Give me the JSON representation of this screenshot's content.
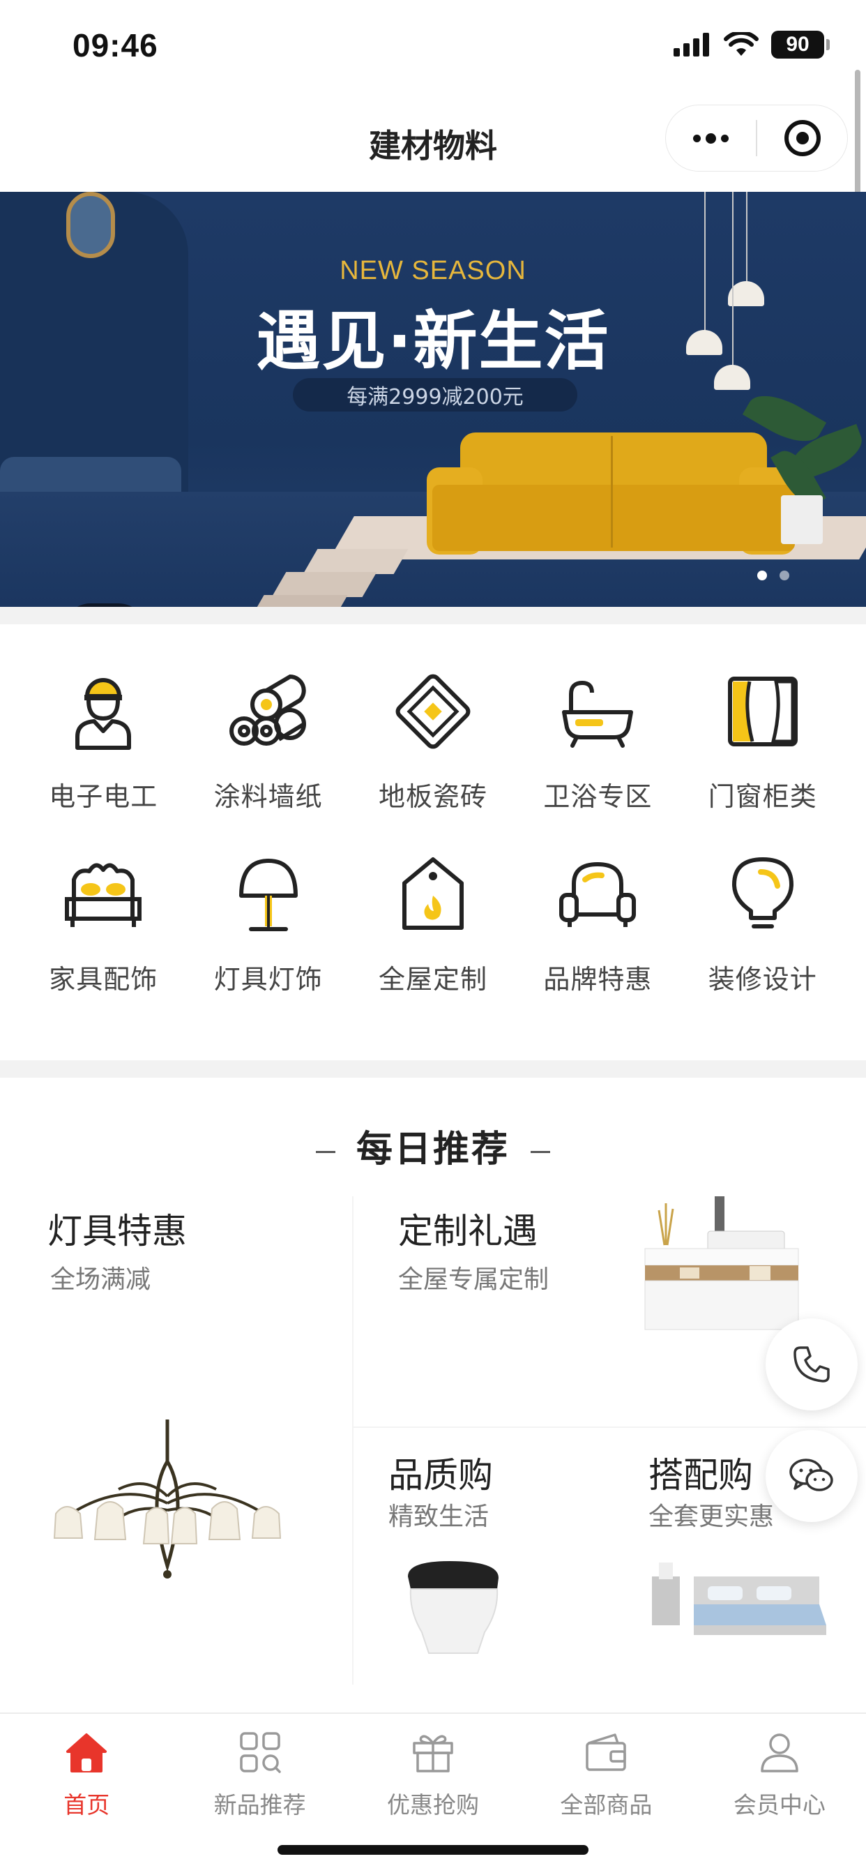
{
  "status_bar": {
    "time": "09:46",
    "battery": "90"
  },
  "nav": {
    "title": "建材物料"
  },
  "banner": {
    "subtitle": "NEW SEASON",
    "title": "遇见·新生活",
    "promo": "每满2999减200元",
    "slide_count": 2,
    "active_slide": 1
  },
  "categories": [
    {
      "label": "电子电工",
      "icon": "electrician-icon"
    },
    {
      "label": "涂料墙纸",
      "icon": "paint-roll-icon"
    },
    {
      "label": "地板瓷砖",
      "icon": "floor-tile-icon"
    },
    {
      "label": "卫浴专区",
      "icon": "bathtub-icon"
    },
    {
      "label": "门窗柜类",
      "icon": "window-curtain-icon"
    },
    {
      "label": "家具配饰",
      "icon": "bed-icon"
    },
    {
      "label": "灯具灯饰",
      "icon": "lamp-icon"
    },
    {
      "label": "全屋定制",
      "icon": "house-tag-icon"
    },
    {
      "label": "品牌特惠",
      "icon": "armchair-icon"
    },
    {
      "label": "装修设计",
      "icon": "lightbulb-icon"
    }
  ],
  "daily": {
    "heading": "每日推荐",
    "cards": [
      {
        "title": "灯具特惠",
        "subtitle": "全场满减",
        "image": "chandelier-image"
      },
      {
        "title": "定制礼遇",
        "subtitle": "全屋专属定制",
        "image": "vanity-cabinet-image"
      },
      {
        "title": "品质购",
        "subtitle": "精致生活",
        "image": "smart-toilet-image"
      },
      {
        "title": "搭配购",
        "subtitle": "全套更实惠",
        "image": "bed-image"
      }
    ]
  },
  "floating": {
    "phone_icon": "phone-icon",
    "chat_icon": "wechat-icon"
  },
  "tabs": [
    {
      "label": "首页",
      "icon": "home-icon",
      "active": true
    },
    {
      "label": "新品推荐",
      "icon": "grid-search-icon",
      "active": false
    },
    {
      "label": "优惠抢购",
      "icon": "gift-icon",
      "active": false
    },
    {
      "label": "全部商品",
      "icon": "wallet-icon",
      "active": false
    },
    {
      "label": "会员中心",
      "icon": "user-icon",
      "active": false
    }
  ],
  "colors": {
    "accent": "#e8352b",
    "icon_yellow": "#f5c518",
    "icon_dark": "#222222"
  }
}
